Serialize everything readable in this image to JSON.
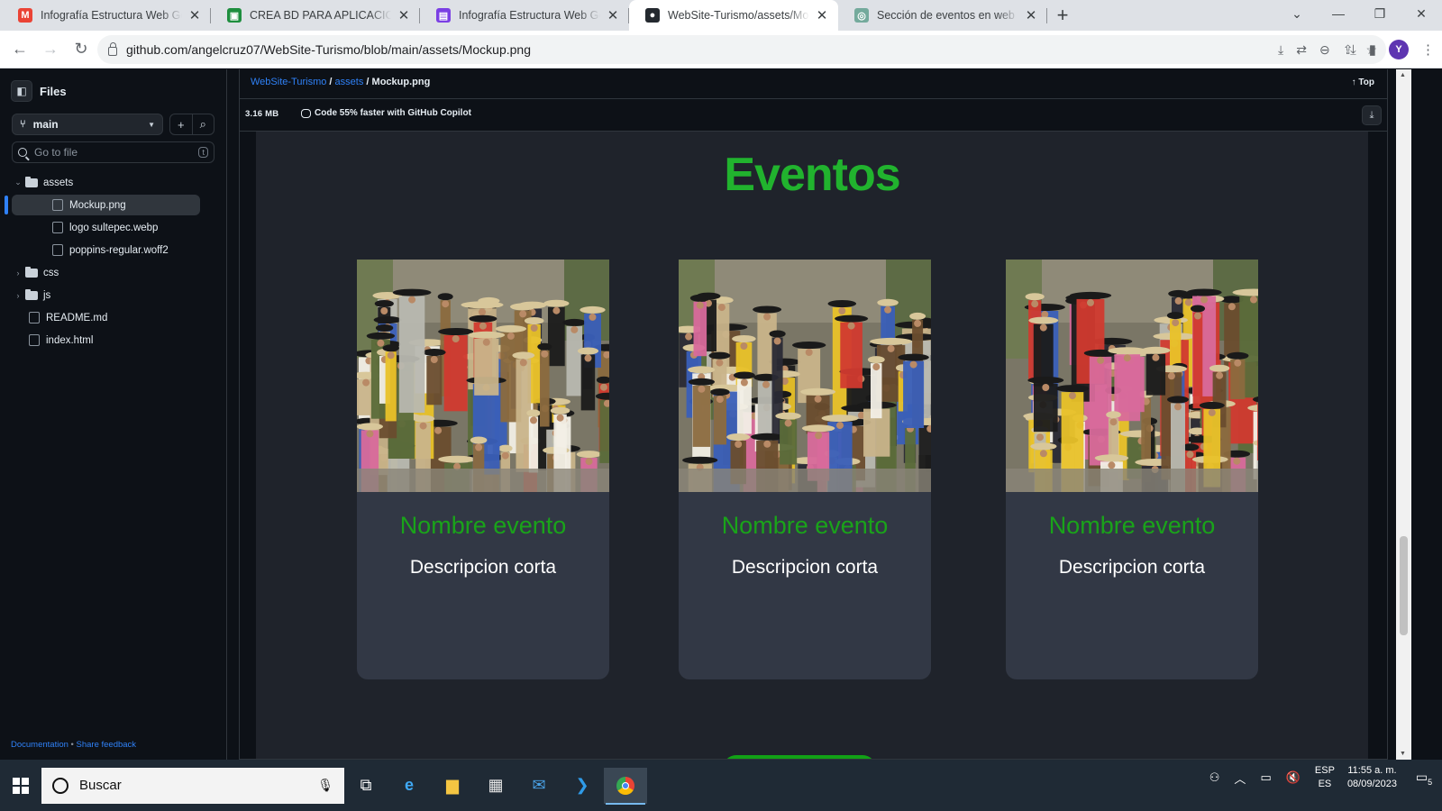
{
  "browser": {
    "tabs": [
      {
        "title": "Infografía Estructura Web Geometr",
        "icon": "gmail-icon",
        "color": "#ea4335",
        "glyph": "M",
        "active": false
      },
      {
        "title": "CREA BD PARA APLICACIONES WEB",
        "icon": "classroom-icon",
        "color": "#1e8e3e",
        "glyph": "▣",
        "active": false
      },
      {
        "title": "Infografía Estructura Web Geometr",
        "icon": "canva-icon",
        "color": "#7b3fe4",
        "glyph": "▤",
        "active": false
      },
      {
        "title": "WebSite-Turismo/assets/Mockup.p",
        "icon": "github-icon",
        "color": "#24292f",
        "glyph": "●",
        "active": true
      },
      {
        "title": "Sección de eventos en web",
        "icon": "chatgpt-icon",
        "color": "#74aa9c",
        "glyph": "◎",
        "active": false
      }
    ],
    "url": "github.com/angelcruz07/WebSite-Turismo/blob/main/assets/Mockup.png",
    "avatar_letter": "Y"
  },
  "sidebar": {
    "title": "Files",
    "branch": "main",
    "search_placeholder": "Go to file",
    "search_shortcut": "t",
    "tree": [
      {
        "label": "assets",
        "type": "folder",
        "expanded": true,
        "depth": 0
      },
      {
        "label": "Mockup.png",
        "type": "file",
        "depth": 1,
        "selected": true
      },
      {
        "label": "logo sultepec.webp",
        "type": "file",
        "depth": 1
      },
      {
        "label": "poppins-regular.woff2",
        "type": "file",
        "depth": 1
      },
      {
        "label": "css",
        "type": "folder",
        "expanded": false,
        "depth": 0
      },
      {
        "label": "js",
        "type": "folder",
        "expanded": false,
        "depth": 0
      },
      {
        "label": "README.md",
        "type": "file",
        "depth": 0
      },
      {
        "label": "index.html",
        "type": "file",
        "depth": 0
      }
    ],
    "footer": {
      "docs": "Documentation",
      "separator": "•",
      "feedback": "Share feedback"
    }
  },
  "viewer": {
    "breadcrumb": {
      "repo": "WebSite-Turismo",
      "folder": "assets",
      "file": "Mockup.png",
      "sep": "/"
    },
    "top_link": "Top",
    "file_size": "3.16 MB",
    "copilot_text": "Code 55% faster with GitHub Copilot"
  },
  "mockup": {
    "heading": "Eventos",
    "accent_color": "#21b32e",
    "cards": [
      {
        "name": "Nombre evento",
        "description": "Descripcion corta"
      },
      {
        "name": "Nombre evento",
        "description": "Descripcion corta"
      },
      {
        "name": "Nombre evento",
        "description": "Descripcion corta"
      }
    ]
  },
  "taskbar": {
    "search_placeholder": "Buscar",
    "apps": [
      "task-view-icon",
      "edge-icon",
      "file-explorer-icon",
      "store-icon",
      "mail-icon",
      "vscode-icon",
      "chrome-icon"
    ],
    "lang_top": "ESP",
    "lang_bottom": "ES",
    "time": "11:55 a. m.",
    "date": "08/09/2023",
    "notifications": "5"
  }
}
